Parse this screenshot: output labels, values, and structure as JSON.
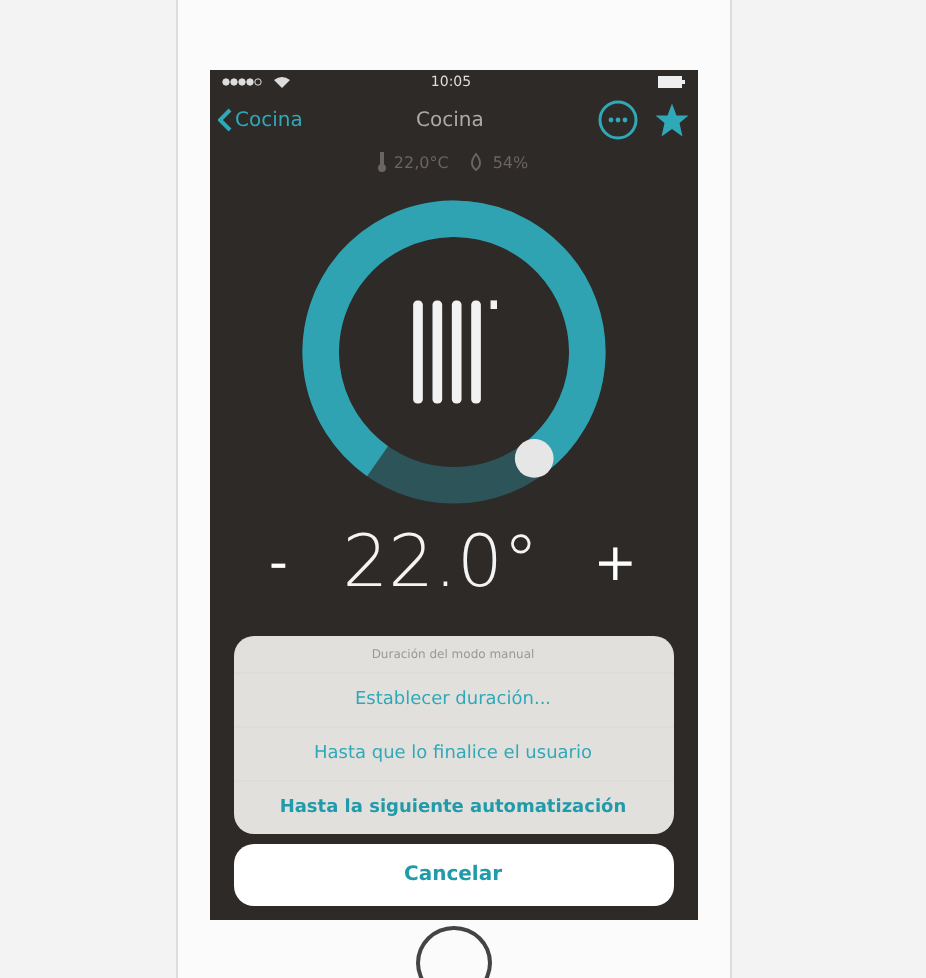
{
  "status_bar": {
    "time": "10:05"
  },
  "nav": {
    "back": "Cocina",
    "title": "Cocina"
  },
  "readings": {
    "temperature": "22,0°C",
    "humidity": "54%"
  },
  "setpoint": {
    "minus": "-",
    "value": "22.0°",
    "plus": "+"
  },
  "action_sheet": {
    "title": "Duración del modo manual",
    "options": [
      {
        "label": "Establecer duración...",
        "bold": false
      },
      {
        "label": "Hasta que lo finalice el usuario",
        "bold": false
      },
      {
        "label": "Hasta la siguiente automatización",
        "bold": true
      }
    ],
    "cancel": "Cancelar"
  }
}
